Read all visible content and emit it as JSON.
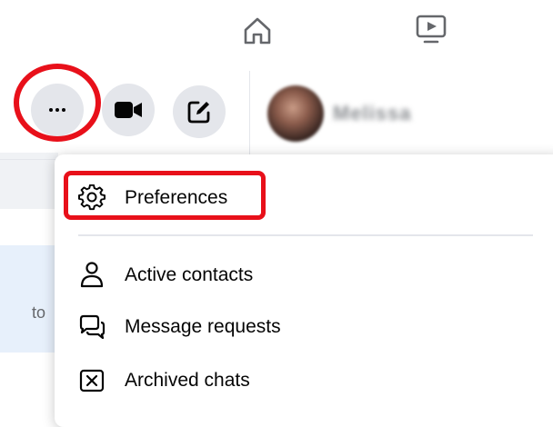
{
  "top_nav": {
    "home_icon": "home-icon",
    "watch_icon": "video-play-icon"
  },
  "toolbar": {
    "more_icon": "more-dots-icon",
    "video_call_icon": "video-camera-icon",
    "new_message_icon": "compose-edit-icon"
  },
  "conversation": {
    "contact_name": "Melissa"
  },
  "left_pane": {
    "truncated_text": "to"
  },
  "menu": {
    "items": [
      {
        "label": "Preferences",
        "icon": "gear-icon"
      },
      {
        "label": "Active contacts",
        "icon": "person-icon"
      },
      {
        "label": "Message requests",
        "icon": "chat-bubbles-icon"
      },
      {
        "label": "Archived chats",
        "icon": "archive-x-icon"
      }
    ]
  },
  "colors": {
    "highlight": "#e8101a",
    "button_bg": "#e4e6eb",
    "text": "#050505",
    "secondary_text": "#65676b"
  }
}
